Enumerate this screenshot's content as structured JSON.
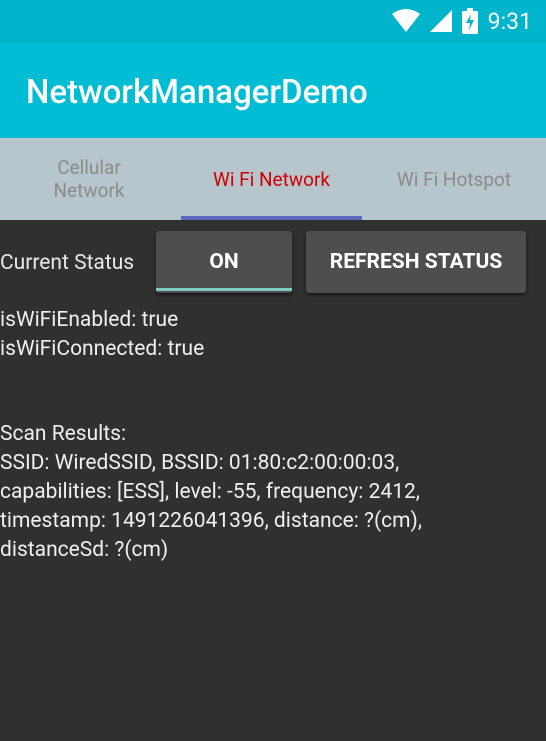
{
  "status_bar": {
    "time": "9:31",
    "icons": [
      "wifi-icon",
      "cellular-signal-icon",
      "battery-charging-icon"
    ]
  },
  "app_bar": {
    "title": "NetworkManagerDemo"
  },
  "tabs": [
    {
      "label_line1": "Cellular",
      "label_line2": "Network",
      "active": false
    },
    {
      "label": "Wi Fi Network",
      "active": true
    },
    {
      "label": "Wi Fi Hotspot",
      "active": false
    }
  ],
  "controls": {
    "status_label": "Current Status",
    "toggle_label": "ON",
    "refresh_label": "REFRESH STATUS"
  },
  "wifi_info": {
    "enabled_line": "isWiFiEnabled: true",
    "connected_line": "isWiFiConnected: true"
  },
  "scan": {
    "heading": "Scan Results:",
    "lines": [
      "SSID: WiredSSID, BSSID: 01:80:c2:00:00:03,",
      "capabilities: [ESS], level: -55, frequency: 2412,",
      "timestamp: 1491226041396, distance: ?(cm),",
      "distanceSd: ?(cm)"
    ]
  },
  "colors": {
    "status_bar": "#00B4CC",
    "app_bar": "#00BCD4",
    "tab_bar": "#B7C5CC",
    "active_tab_text": "#D00000",
    "tab_indicator": "#5C6BC0",
    "background": "#303030"
  }
}
